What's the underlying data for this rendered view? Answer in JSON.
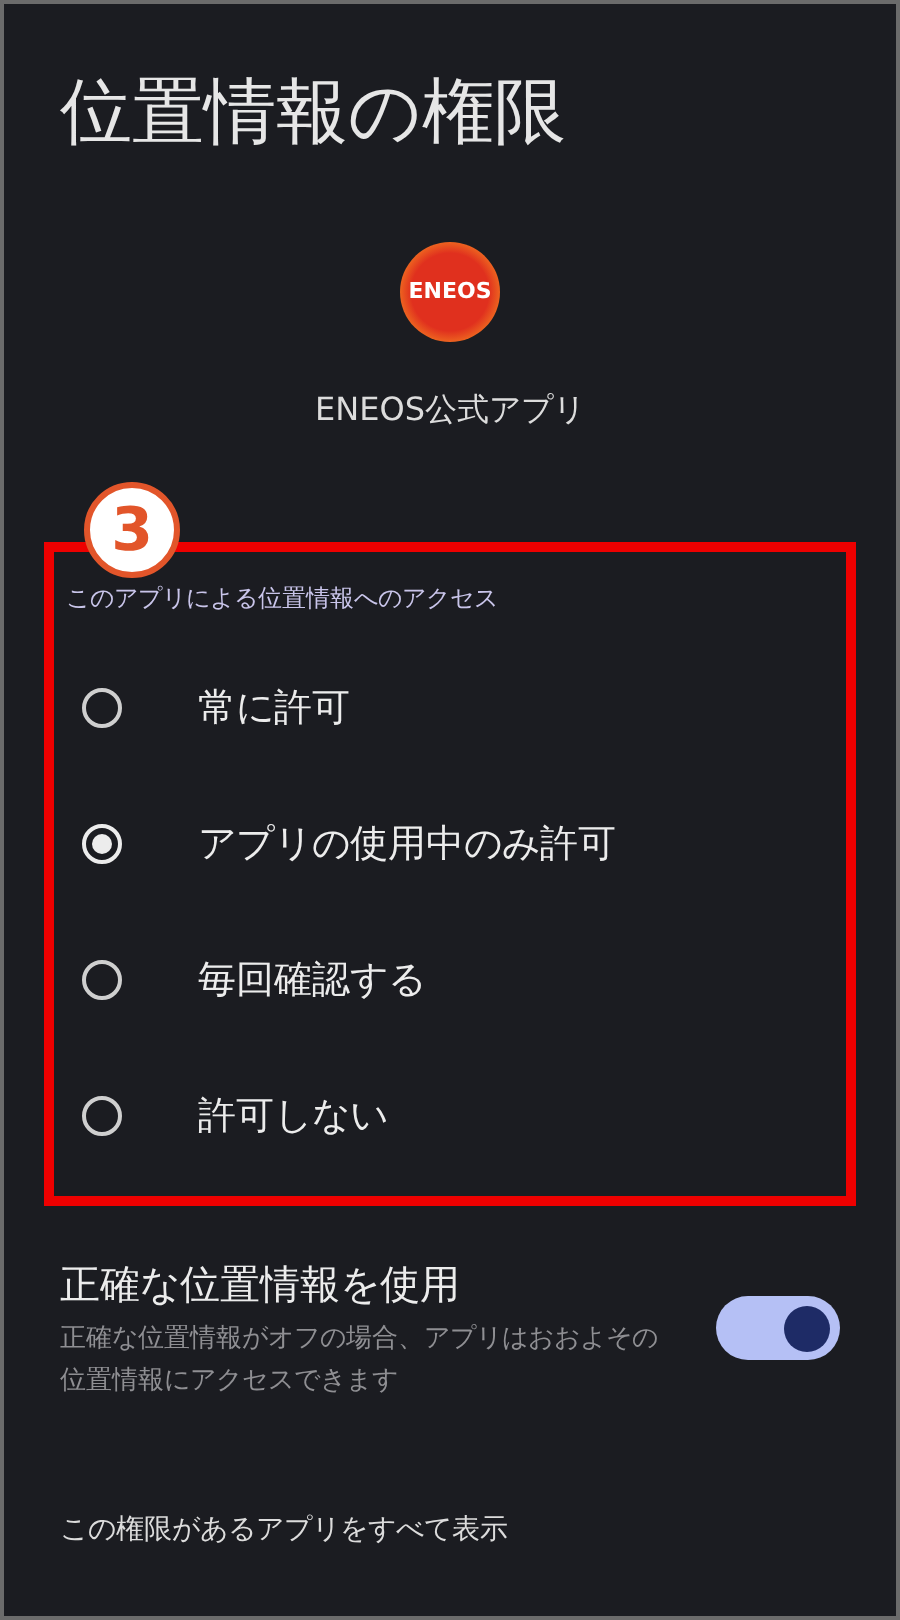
{
  "title": "位置情報の権限",
  "app": {
    "logo_text": "ENEOS",
    "name": "ENEOS公式アプリ"
  },
  "step_badge": "3",
  "access": {
    "label": "このアプリによる位置情報へのアクセス",
    "options": [
      {
        "label": "常に許可",
        "selected": false
      },
      {
        "label": "アプリの使用中のみ許可",
        "selected": true
      },
      {
        "label": "毎回確認する",
        "selected": false
      },
      {
        "label": "許可しない",
        "selected": false
      }
    ]
  },
  "precise": {
    "title": "正確な位置情報を使用",
    "description": "正確な位置情報がオフの場合、アプリはおおよその位置情報にアクセスできます",
    "on": true
  },
  "footer_link": "この権限があるアプリをすべて表示"
}
